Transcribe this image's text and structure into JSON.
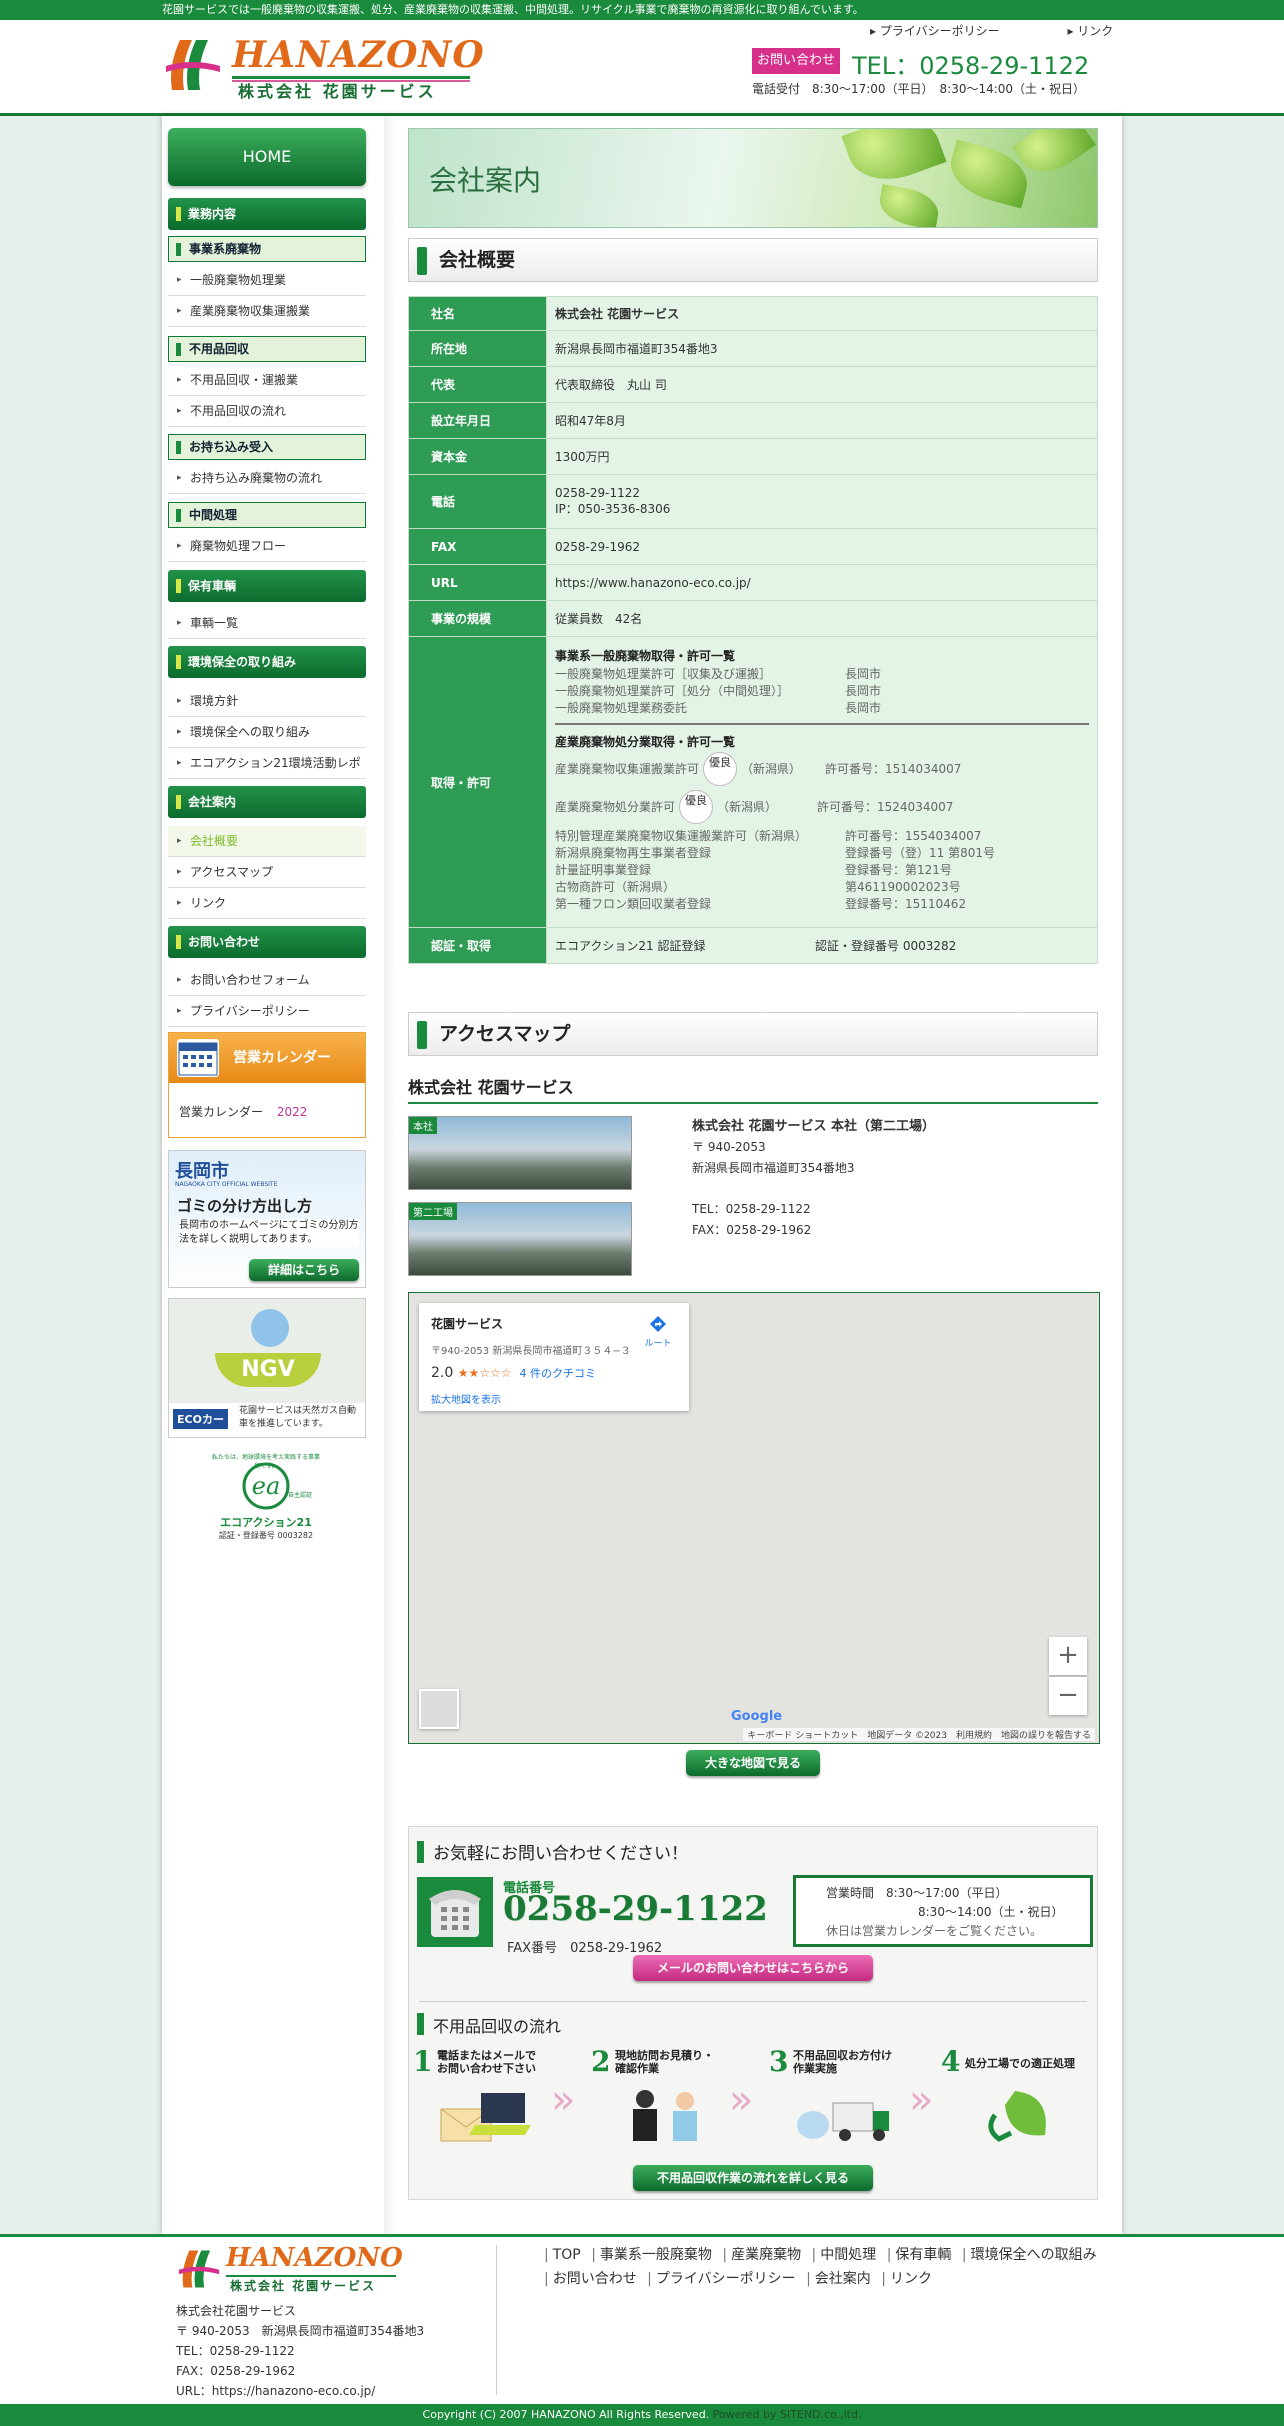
{
  "topbar": {
    "text": "花園サービスでは一般廃棄物の収集運搬、処分、産業廃棄物の収集運搬、中間処理。リサイクル事業で廃棄物の再資源化に取り組んでいます。"
  },
  "header": {
    "logo_en": "HANAZONO",
    "logo_jp": "株式会社 花園サービス",
    "links": [
      "プライバシーポリシー",
      "リンク"
    ],
    "contact_button": "お問い合わせ",
    "tel": "TEL：0258-29-1122",
    "hours": "電話受付　8:30〜17:00（平日）　8:30〜14:00（土・祝日）"
  },
  "sidebar": {
    "home": "HOME",
    "groups": [
      {
        "title": "業務内容"
      },
      {
        "sub": "事業系廃棄物",
        "items": [
          "一般廃棄物処理業",
          "産業廃棄物収集運搬業"
        ]
      },
      {
        "sub": "不用品回収",
        "items": [
          "不用品回収・運搬業",
          "不用品回収の流れ"
        ]
      },
      {
        "sub": "お持ち込み受入",
        "items": [
          "お持ち込み廃棄物の流れ"
        ]
      },
      {
        "sub": "中間処理",
        "items": [
          "廃棄物処理フロー"
        ]
      },
      {
        "title": "保有車輌",
        "items": [
          "車輌一覧"
        ]
      },
      {
        "title": "環境保全の取り組み",
        "items": [
          "環境方針",
          "環境保全への取り組み",
          "エコアクション21環境活動レポート"
        ]
      },
      {
        "title": "会社案内",
        "items": [
          "会社概要",
          "アクセスマップ",
          "リンク"
        ]
      },
      {
        "title": "お問い合わせ",
        "items": [
          "お問い合わせフォーム",
          "プライバシーポリシー"
        ]
      }
    ],
    "calendar": {
      "title": "営業カレンダー",
      "label": "営業カレンダー",
      "year": "2022"
    },
    "nagaoka": {
      "city": "長岡市",
      "city_en": "NAGAOKA CITY OFFICIAL WEBSITE",
      "headline": "ゴミの分け方出し方",
      "body": "長岡市のホームページにてゴミの分別方法を詳しく説明してあります。",
      "button": "詳細はこちら"
    },
    "ngv": {
      "badge": "NGV",
      "eco": "ECOカー",
      "text": "花園サービスは天然ガス自動車を推進しています。"
    },
    "eco_action": {
      "name": "エコアクション21",
      "arc": "私たちは、地球環境を考え実践する事業所です。",
      "sub": "自主認証",
      "reg": "認証・登録番号 0003282"
    }
  },
  "hero": {
    "title": "会社案内"
  },
  "overview": {
    "heading": "会社概要",
    "rows": [
      {
        "k": "社名",
        "v": "株式会社 花園サービス"
      },
      {
        "k": "所在地",
        "v": "新潟県長岡市福道町354番地3"
      },
      {
        "k": "代表",
        "v": "代表取締役　丸山 司"
      },
      {
        "k": "設立年月日",
        "v": "昭和47年8月"
      },
      {
        "k": "資本金",
        "v": "1300万円"
      },
      {
        "k": "電話",
        "v": "0258-29-1122",
        "v2": "IP：050-3536-8306"
      },
      {
        "k": "FAX",
        "v": "0258-29-1962"
      },
      {
        "k": "URL",
        "v": "https://www.hanazono-eco.co.jp/"
      },
      {
        "k": "事業の規模",
        "v": "従業員数　42名"
      },
      {
        "k": "取得・許可"
      },
      {
        "k": "認証・取得",
        "v": "エコアクション21 認証登録",
        "v2": "認証・登録番号 0003282"
      }
    ],
    "license": {
      "general_title": "事業系一般廃棄物取得・許可一覧",
      "general": [
        [
          "一般廃棄物処理業許可［収集及び運搬］",
          "長岡市"
        ],
        [
          "一般廃棄物処理業許可［処分（中間処理）］",
          "長岡市"
        ],
        [
          "一般廃棄物処理業務委託",
          "長岡市"
        ]
      ],
      "industrial_title": "産業廃棄物処分業取得・許可一覧",
      "yuryo": "優良",
      "ind1": [
        "産業廃棄物収集運搬業許可",
        "（新潟県）",
        "許可番号：1514034007"
      ],
      "ind2": [
        "産業廃棄物処分業許可",
        "（新潟県）",
        "許可番号：1524034007"
      ],
      "others": [
        [
          "特別管理産業廃棄物収集運搬業許可（新潟県）",
          "許可番号：1554034007"
        ],
        [
          "新潟県廃棄物再生事業者登録",
          "登録番号（登）11 第801号"
        ],
        [
          "計量証明事業登録",
          "登録番号：第121号"
        ],
        [
          "古物商許可（新潟県）",
          "第461190002023号"
        ],
        [
          "第一種フロン類回収業者登録",
          "登録番号：15110462"
        ]
      ]
    }
  },
  "access": {
    "heading": "アクセスマップ",
    "company": "株式会社 花園サービス",
    "photo1_tag": "本社",
    "photo2_tag": "第二工場",
    "office_title": "株式会社 花園サービス 本社（第二工場）",
    "zip": "〒 940-2053",
    "address": "新潟県長岡市福道町354番地3",
    "tel": "TEL：0258-29-1122",
    "fax": "FAX：0258-29-1962",
    "map": {
      "place": "花園サービス",
      "addr": "〒940-2053 新潟県長岡市福道町３５４−３",
      "rating": "2.0",
      "stars": "★★☆☆☆",
      "reviews": "4 件のクチコミ",
      "link": "拡大地図を表示",
      "route": "ルート",
      "google": "Google",
      "footer": "キーボード ショートカット　地図データ ©2023　利用規約　地図の誤りを報告する",
      "zoom_in": "+",
      "zoom_out": "−"
    },
    "big_map_button": "大きな地図で見る"
  },
  "contact": {
    "title": "お気軽にお問い合わせください！",
    "phone_label": "電話番号",
    "phone": "0258-29-1122",
    "fax": "FAX番号　0258-29-1962",
    "hours1": "営業時間　8:30〜17:00（平日）",
    "hours2": "8:30〜14:00（土・祝日）",
    "hours_note": "休日は営業カレンダーをご覧ください。",
    "mail_button": "メールのお問い合わせはこちらから",
    "flow_title": "不用品回収の流れ",
    "steps": [
      {
        "n": "1",
        "t": "電話またはメールでお問い合わせ下さい"
      },
      {
        "n": "2",
        "t": "現地訪問お見積り・確認作業"
      },
      {
        "n": "3",
        "t": "不用品回収お方付け作業実施"
      },
      {
        "n": "4",
        "t": "処分工場での適正処理"
      }
    ],
    "flow_button": "不用品回収作業の流れを詳しく見る"
  },
  "footer": {
    "logo_en": "HANAZONO",
    "logo_jp": "株式会社 花園サービス",
    "info": [
      "株式会社花園サービス",
      "〒 940-2053　新潟県長岡市福道町354番地3",
      "TEL：0258-29-1122",
      "FAX：0258-29-1962",
      "URL：https://hanazono-eco.co.jp/"
    ],
    "nav1": [
      "TOP",
      "事業系一般廃棄物",
      "産業廃棄物",
      "中間処理",
      "保有車輌",
      "環境保全への取組み"
    ],
    "nav2": [
      "お問い合わせ",
      "プライバシーポリシー",
      "会社案内",
      "リンク"
    ],
    "copyright": "Copyright (C) 2007 HANAZONO All Rights Reserved.",
    "powered": "Powered by SITEND.co.,ltd."
  },
  "colors": {
    "brand_green": "#1a8a3c",
    "accent_pink": "#d6308b",
    "logo_orange": "#e06a1a"
  },
  "icons": [
    "arrow-bullet-icon",
    "calendar-icon",
    "telephone-icon",
    "directions-icon",
    "star-icon"
  ]
}
